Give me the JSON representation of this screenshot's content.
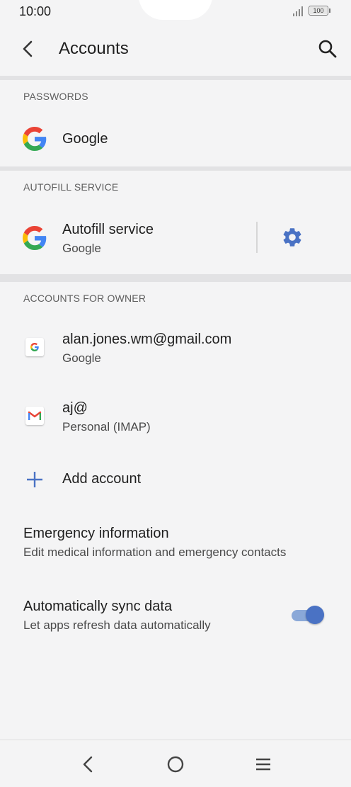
{
  "status": {
    "time": "10:00",
    "battery": "100"
  },
  "header": {
    "title": "Accounts"
  },
  "sections": {
    "passwords": {
      "header": "PASSWORDS",
      "item": {
        "label": "Google"
      }
    },
    "autofill": {
      "header": "AUTOFILL SERVICE",
      "item": {
        "title": "Autofill service",
        "subtitle": "Google"
      }
    },
    "accounts": {
      "header": "ACCOUNTS FOR OWNER",
      "items": [
        {
          "title": "alan.jones.wm@gmail.com",
          "subtitle": "Google"
        },
        {
          "title": "aj@",
          "subtitle": "Personal (IMAP)"
        }
      ],
      "add_label": "Add account"
    }
  },
  "emergency": {
    "title": "Emergency information",
    "subtitle": "Edit medical information and emergency contacts"
  },
  "sync": {
    "title": "Automatically sync data",
    "subtitle": "Let apps refresh data automatically",
    "enabled": true
  },
  "colors": {
    "accent": "#4a72c4",
    "background": "#f4f4f5",
    "divider": "#e2e2e4"
  }
}
